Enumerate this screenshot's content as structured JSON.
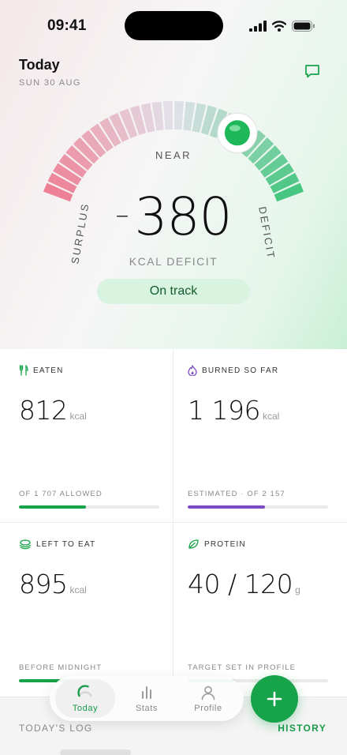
{
  "status_bar": {
    "time": "09:41"
  },
  "header": {
    "title": "Today",
    "date": "SUN 30 AUG"
  },
  "gauge": {
    "minus_sign": "–",
    "value": "380",
    "unit_label": "KCAL DEFICIT",
    "status": "On track",
    "label_surplus": "SURPLUS",
    "label_near": "NEAR",
    "label_deficit": "DEFICIT",
    "marker_position_fraction": 0.72
  },
  "cards": {
    "eaten": {
      "title": "EATEN",
      "value": "812",
      "unit": "kcal",
      "footer": "OF 1 707 ALLOWED",
      "progress": 0.48,
      "color": "#17a34a"
    },
    "burned": {
      "title": "BURNED SO FAR",
      "value": "1 196",
      "unit": "kcal",
      "footer": "ESTIMATED · OF 2 157",
      "progress": 0.55,
      "color": "#7b4bc4"
    },
    "left": {
      "title": "LEFT TO EAT",
      "value": "895",
      "unit": "kcal",
      "footer": "BEFORE MIDNIGHT",
      "progress": 0.52,
      "color": "#17a34a"
    },
    "protein": {
      "title": "PROTEIN",
      "value": "40 / 120",
      "unit": "g",
      "footer": "TARGET SET IN PROFILE",
      "progress": 0.33,
      "color": "#17a34a"
    }
  },
  "log": {
    "label": "TODAY'S LOG",
    "history_link": "HISTORY"
  },
  "tabbar": {
    "tabs": [
      {
        "label": "Today"
      },
      {
        "label": "Stats"
      },
      {
        "label": "Profile"
      }
    ]
  },
  "colors": {
    "accent": "#17a34a",
    "surplus": "#ee8398",
    "deficit": "#4fc982",
    "burned": "#7b4bc4"
  },
  "icons": {
    "chat": "chat-bubble-icon",
    "eaten": "fork-knife-icon",
    "burned": "flame-icon",
    "left": "plate-icon",
    "protein": "leaf-icon",
    "add": "plus-icon"
  }
}
